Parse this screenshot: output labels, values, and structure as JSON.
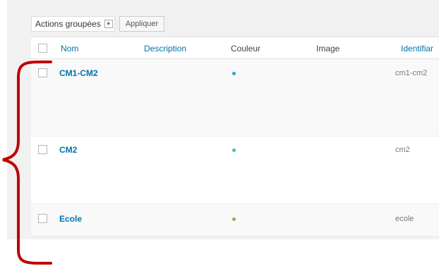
{
  "toolbar": {
    "bulk_actions_label": "Actions groupées",
    "apply_label": "Appliquer"
  },
  "table": {
    "columns": {
      "name": "Nom",
      "description": "Description",
      "color": "Couleur",
      "image": "Image",
      "slug": "Identifiar"
    },
    "rows": [
      {
        "name": "CM1-CM2",
        "slug": "cm1-cm2",
        "color": "#2ea2cc"
      },
      {
        "name": "CM2",
        "slug": "cm2",
        "color": "#3ec4a8"
      },
      {
        "name": "Ecole",
        "slug": "ecole",
        "color": "#9aa84a"
      }
    ]
  },
  "annotation": {
    "bracket_color": "#c00000"
  }
}
